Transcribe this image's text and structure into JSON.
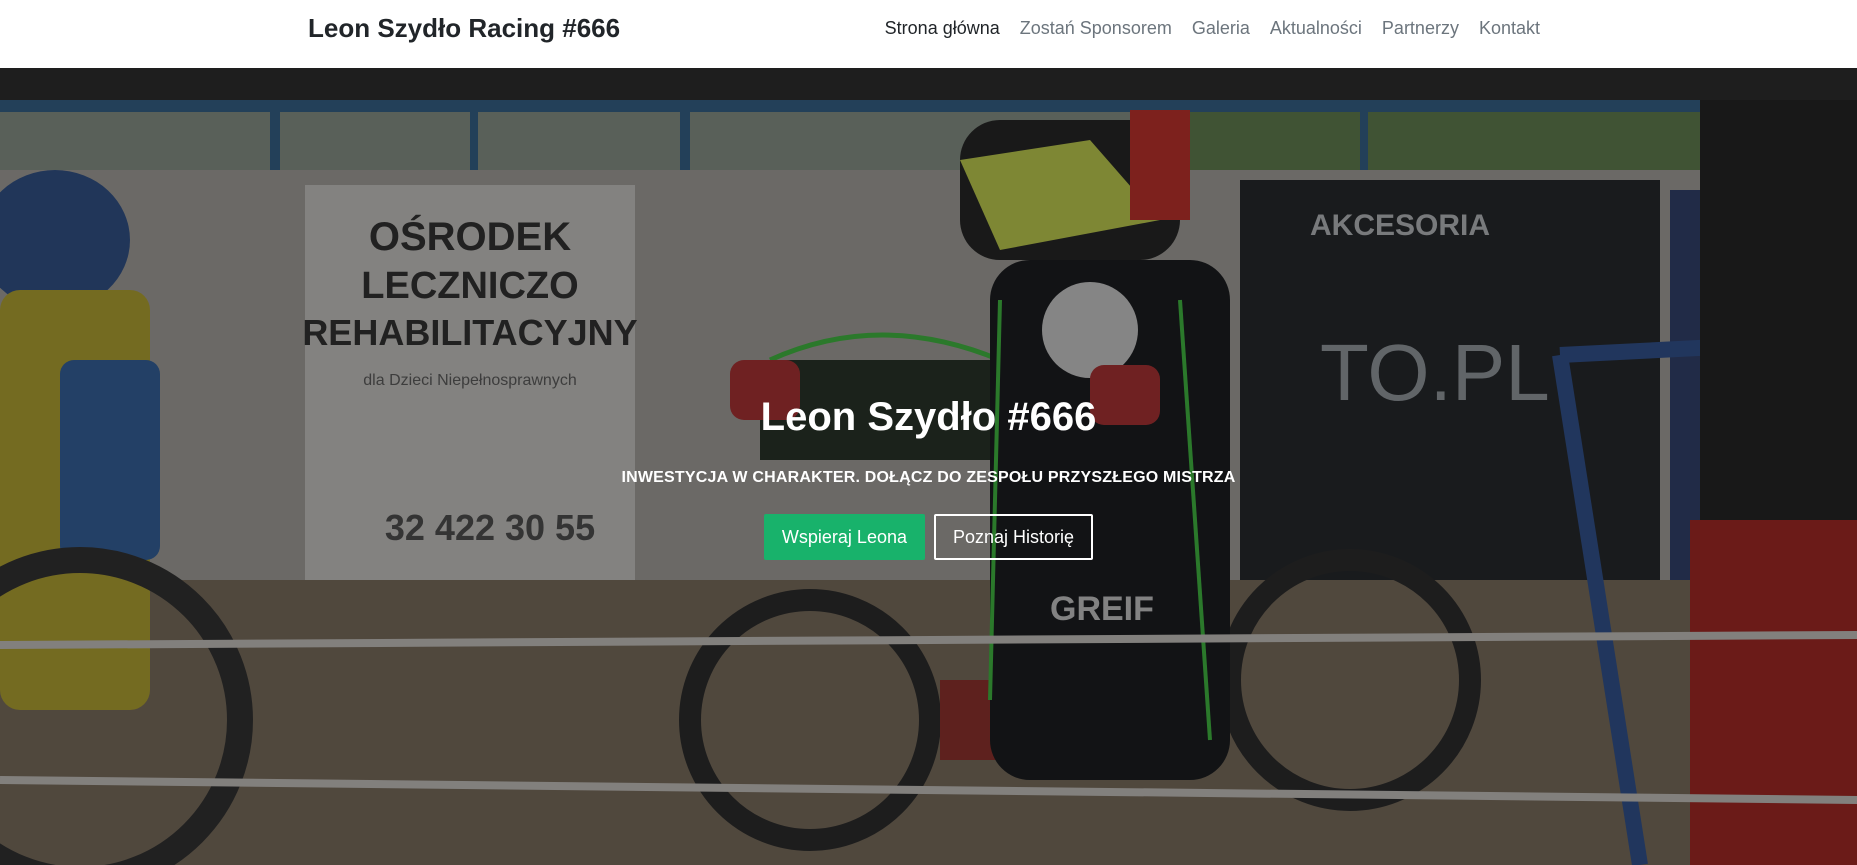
{
  "navbar": {
    "brand": "Leon Szydło Racing #666",
    "links": [
      {
        "label": "Strona główna"
      },
      {
        "label": "Zostań Sponsorem"
      },
      {
        "label": "Galeria"
      },
      {
        "label": "Aktualności"
      },
      {
        "label": "Partnerzy"
      },
      {
        "label": "Kontakt"
      }
    ]
  },
  "hero": {
    "title": "Leon Szydło #666",
    "subtitle": "INWESTYCJA W CHARAKTER. DOŁĄCZ DO ZESPOŁU PRZYSZŁEGO MISTRZA",
    "primary_button": "Wspieraj Leona",
    "secondary_button": "Poznaj Historię",
    "background_banner_lines": [
      "OŚRODEK",
      "LECZNICZO",
      "REHABILITACYJNY"
    ],
    "background_banner_small": "dla Dzieci Niepełnosprawnych",
    "background_phone": "32 422 30 55",
    "background_ad_text": "AKCESORIA",
    "background_ad_domain": "TO.PL",
    "sponsor_logo": "GREIF"
  },
  "colors": {
    "primary": "#18b26b",
    "navbar_bg": "#ffffff",
    "text_dark": "#212529",
    "text_muted": "#6c757d"
  }
}
